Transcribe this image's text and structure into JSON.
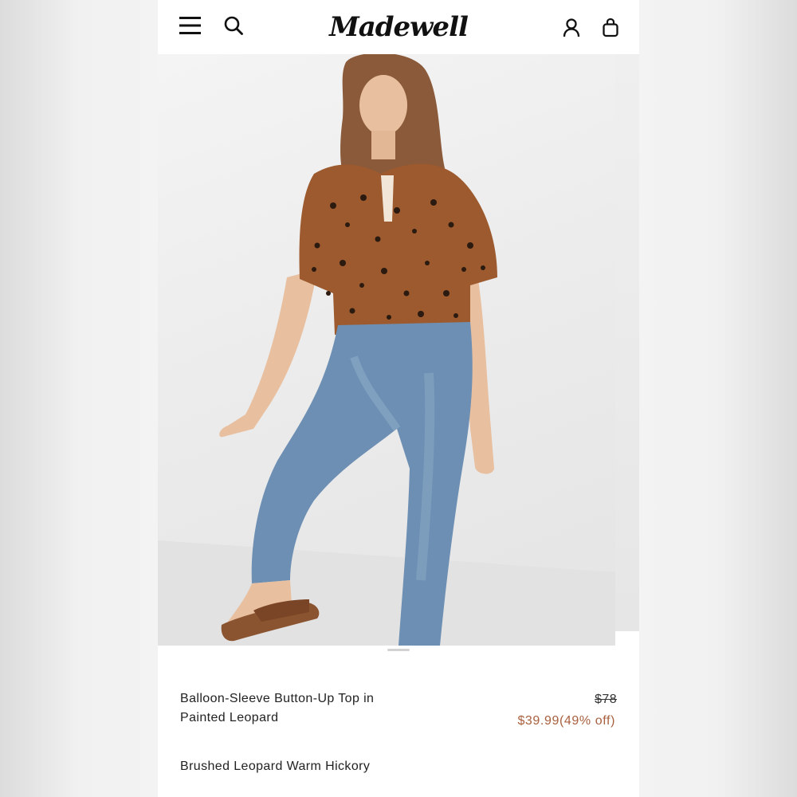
{
  "header": {
    "logo_text": "Madewell",
    "icons": {
      "menu": "hamburger-menu-icon",
      "search": "search-icon",
      "account": "account-icon",
      "bag": "shopping-bag-icon"
    }
  },
  "hero_image": {
    "subject": "Model wearing leopard-print balloon-sleeve top and light-wash jeans with brown slide sandals",
    "colors": {
      "background": "#ececec",
      "top": "#9c5a2e",
      "jeans": "#6d8fb3",
      "sandals": "#8b5430",
      "skin": "#e8bf9f",
      "hair": "#8a5a3a"
    }
  },
  "product": {
    "name": "Balloon-Sleeve Button-Up Top in Painted Leopard",
    "original_price": "$78",
    "sale_price": "$39.99(49% off)",
    "color_name": "Brushed Leopard Warm Hickory"
  },
  "colors": {
    "sale_price": "#a8603f",
    "text": "#222222"
  }
}
